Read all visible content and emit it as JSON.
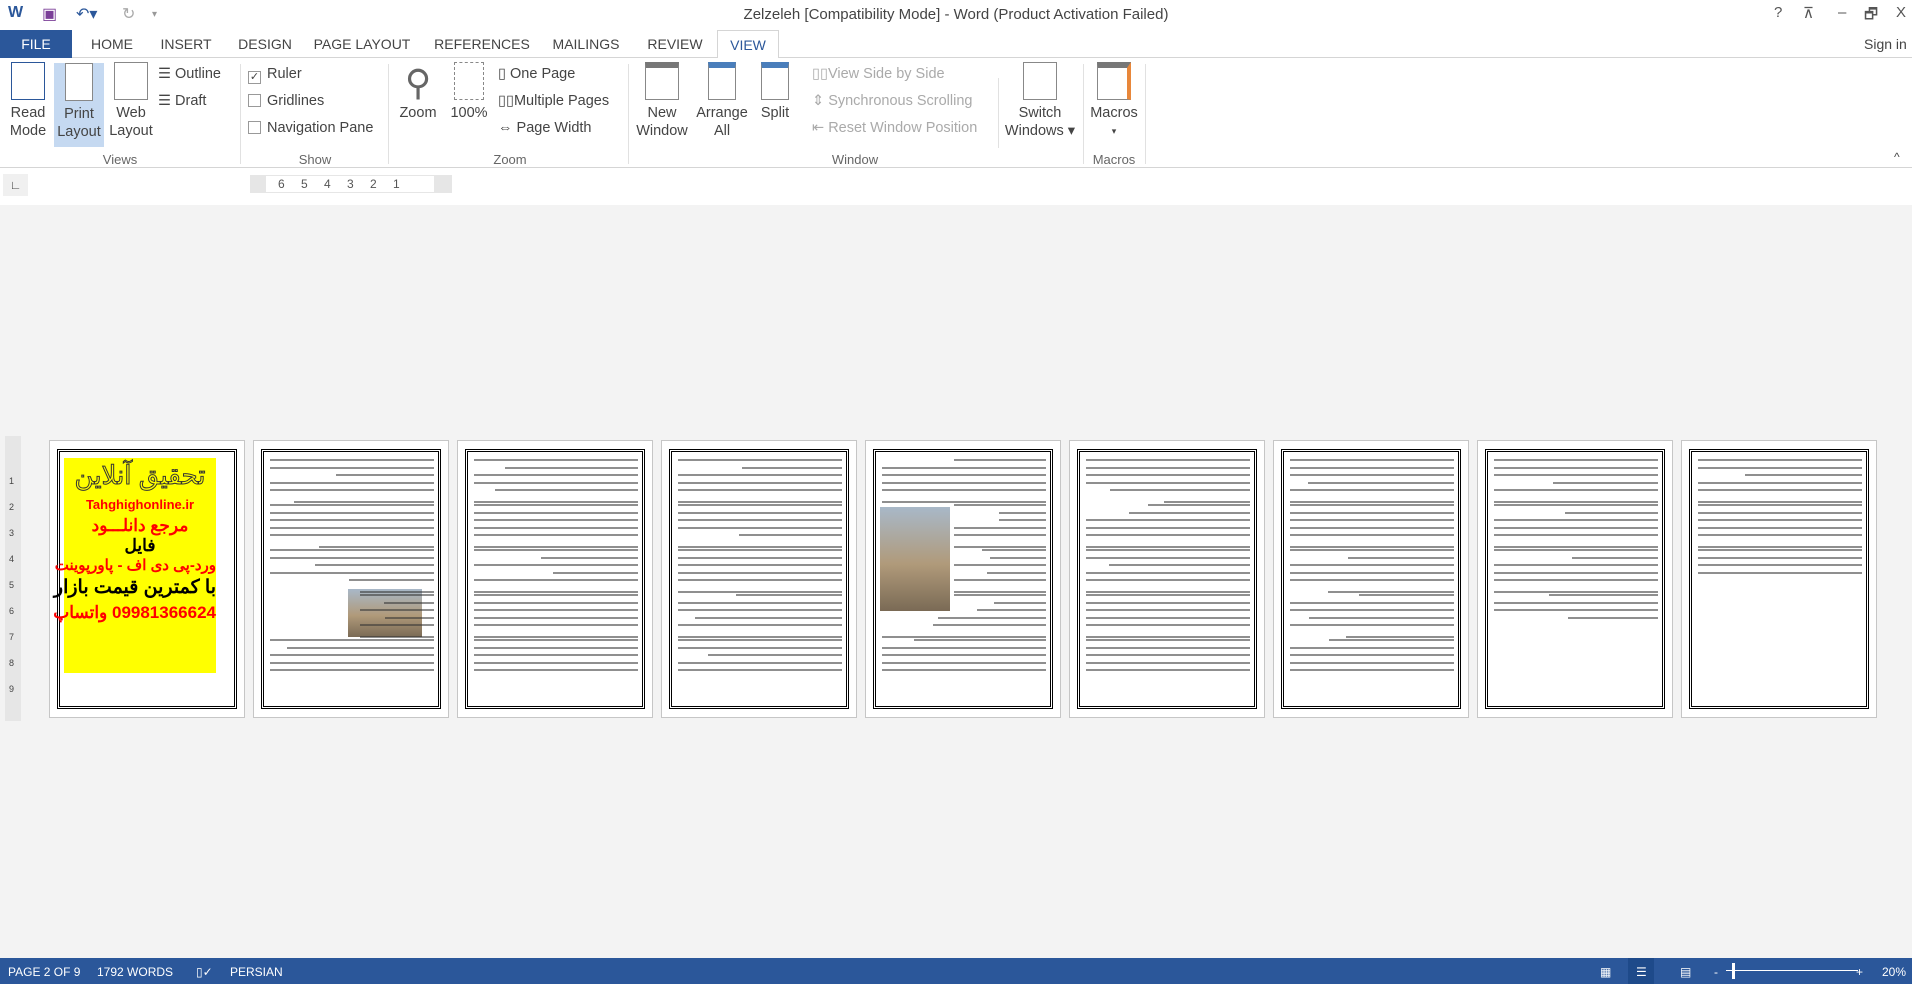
{
  "titlebar": {
    "title": "Zelzeleh [Compatibility Mode] - Word (Product Activation Failed)",
    "help": "?",
    "restore_ribbon": "⊼",
    "minimize": "–",
    "maximize": "🗗",
    "close": "X"
  },
  "tabs": [
    {
      "label": "FILE"
    },
    {
      "label": "HOME"
    },
    {
      "label": "INSERT"
    },
    {
      "label": "DESIGN"
    },
    {
      "label": "PAGE LAYOUT"
    },
    {
      "label": "REFERENCES"
    },
    {
      "label": "MAILINGS"
    },
    {
      "label": "REVIEW"
    },
    {
      "label": "VIEW",
      "active": true
    }
  ],
  "sign_in": "Sign in",
  "ribbon": {
    "views": {
      "label": "Views",
      "read_mode": [
        "Read",
        "Mode"
      ],
      "print_layout": [
        "Print",
        "Layout"
      ],
      "web_layout": [
        "Web",
        "Layout"
      ],
      "outline": "Outline",
      "draft": "Draft"
    },
    "show": {
      "label": "Show",
      "ruler": "Ruler",
      "ruler_checked": true,
      "gridlines": "Gridlines",
      "gridlines_checked": false,
      "navigation_pane": "Navigation Pane",
      "navigation_checked": false
    },
    "zoom": {
      "label": "Zoom",
      "zoom": "Zoom",
      "hundred": "100%",
      "one_page": "One Page",
      "multiple_pages": "Multiple Pages",
      "page_width": "Page Width"
    },
    "window": {
      "label": "Window",
      "new_window": [
        "New",
        "Window"
      ],
      "arrange_all": [
        "Arrange",
        "All"
      ],
      "split": "Split",
      "side_by_side": "View Side by Side",
      "sync_scroll": "Synchronous Scrolling",
      "reset_position": "Reset Window Position",
      "switch_windows": [
        "Switch",
        "Windows ▾"
      ]
    },
    "macros": {
      "label": "Macros",
      "macros": "Macros",
      "arrow": "▾"
    }
  },
  "ruler": {
    "ticks": [
      "6",
      "5",
      "4",
      "3",
      "2",
      "1"
    ]
  },
  "vruler": {
    "ticks": [
      "1",
      "2",
      "3",
      "4",
      "5",
      "6",
      "7",
      "8",
      "9"
    ]
  },
  "ad": {
    "title": "تحقیق آنلاین",
    "site": "Tahghighonline.ir",
    "line1": "مرجع دانلـــود",
    "line2": "فایل",
    "line3": "ورد-پی دی اف - پاورپوینت",
    "line4": "با کمترین قیمت بازار",
    "phone": "09981366624",
    "whatsapp": "واتساپ"
  },
  "status": {
    "page": "PAGE 2 OF 9",
    "words": "1792 WORDS",
    "language": "PERSIAN",
    "zoom": "20%"
  },
  "colors": {
    "accent": "#2b579a",
    "ad_bg": "#ffff00",
    "ad_red": "#ff0000"
  }
}
